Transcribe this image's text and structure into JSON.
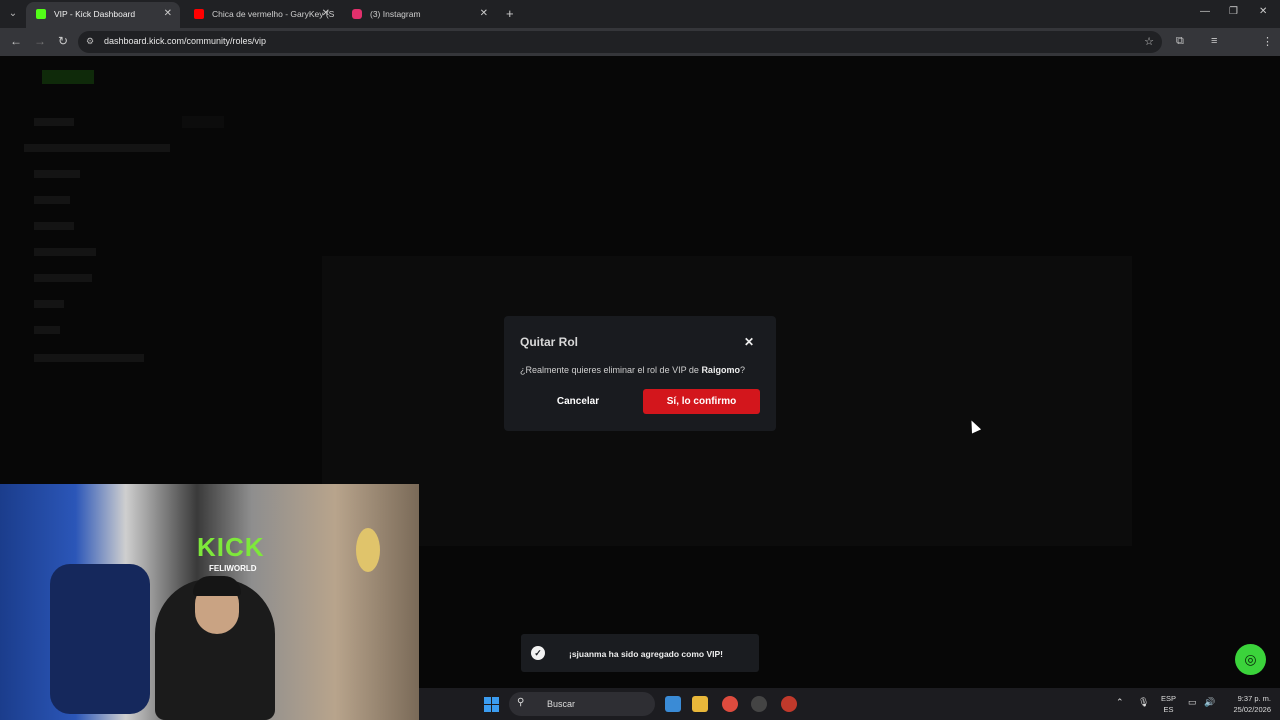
{
  "browser": {
    "tabs": [
      {
        "title": "VIP - Kick Dashboard",
        "favicon": "kick-icon",
        "active": true,
        "color": "#53fc18"
      },
      {
        "title": "Chica de vermelho - GaryKey (S",
        "favicon": "youtube-icon",
        "active": false,
        "color": "#ff0000"
      },
      {
        "title": "(3) Instagram",
        "favicon": "instagram-icon",
        "active": false,
        "color": "#e1306c"
      }
    ],
    "url": "dashboard.kick.com/community/roles/vip"
  },
  "modal": {
    "title": "Quitar Rol",
    "message_prefix": "¿Realmente quieres eliminar el rol de VIP de ",
    "username": "Raigomo",
    "message_suffix": "?",
    "cancel_label": "Cancelar",
    "confirm_label": "Sí, lo confirmo",
    "confirm_color": "#d3161c"
  },
  "toast": {
    "message": "¡sjuanma ha sido agregado como VIP!"
  },
  "webcam": {
    "banner_text": "KICK",
    "banner_sub": "FELIWORLD"
  },
  "taskbar": {
    "search_placeholder": "Buscar",
    "lang_top": "ESP",
    "lang_bottom": "ES",
    "time": "9:37 p. m.",
    "date": "25/02/2026"
  },
  "colors": {
    "brand": "#53fc18",
    "help_button": "#3bd33b"
  }
}
